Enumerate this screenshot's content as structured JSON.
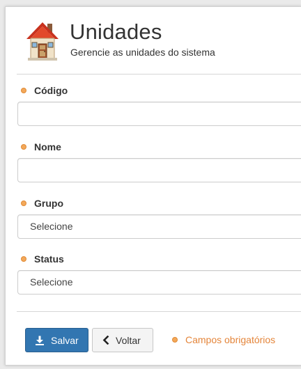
{
  "header": {
    "icon": "house-icon",
    "title": "Unidades",
    "subtitle": "Gerencie as unidades do sistema"
  },
  "form": {
    "codigo": {
      "label": "Código",
      "value": ""
    },
    "nome": {
      "label": "Nome",
      "value": ""
    },
    "grupo": {
      "label": "Grupo",
      "selected": "Selecione"
    },
    "status": {
      "label": "Status",
      "selected": "Selecione"
    }
  },
  "actions": {
    "save_label": "Salvar",
    "save_icon": "download-icon",
    "back_label": "Voltar",
    "back_icon": "chevron-left-icon"
  },
  "required_note": "Campos obrigatórios",
  "colors": {
    "primary": "#3276b1",
    "required_bullet": "#f3a85a",
    "required_text": "#e4853a"
  }
}
